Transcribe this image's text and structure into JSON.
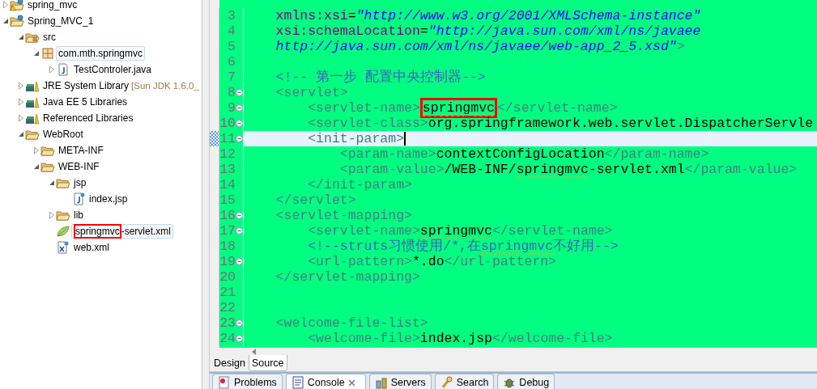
{
  "project_explorer": {
    "items": [
      {
        "label": "spring_mvc",
        "kind": "project-warning",
        "expanded": false,
        "selected": false
      },
      {
        "label": "Spring_MVC_1",
        "kind": "project",
        "expanded": true,
        "selected": false,
        "children": [
          {
            "label": "src",
            "kind": "source-folder",
            "expanded": true,
            "selected": false,
            "children": [
              {
                "label": "com.mth.springmvc",
                "kind": "package",
                "expanded": true,
                "selected": true,
                "children": [
                  {
                    "label": "TestControler.java",
                    "kind": "java-file",
                    "expanded": false,
                    "selected": false
                  }
                ]
              }
            ]
          },
          {
            "label": "JRE System Library",
            "decoration": "[Sun JDK 1.6.0_",
            "kind": "library",
            "expanded": false,
            "selected": false
          },
          {
            "label": "Java EE 5 Libraries",
            "kind": "library",
            "expanded": false,
            "selected": false
          },
          {
            "label": "Referenced Libraries",
            "kind": "library",
            "expanded": false,
            "selected": false
          },
          {
            "label": "WebRoot",
            "kind": "folder",
            "expanded": true,
            "selected": false,
            "children": [
              {
                "label": "META-INF",
                "kind": "folder",
                "expanded": false,
                "selected": false
              },
              {
                "label": "WEB-INF",
                "kind": "folder",
                "expanded": true,
                "selected": false,
                "children": [
                  {
                    "label": "jsp",
                    "kind": "folder",
                    "expanded": true,
                    "selected": false,
                    "children": [
                      {
                        "label": "index.jsp",
                        "kind": "jsp-file",
                        "selected": false
                      }
                    ]
                  },
                  {
                    "label": "lib",
                    "kind": "folder",
                    "expanded": false,
                    "selected": false
                  },
                  {
                    "label_framed": "springmvc",
                    "label": "-servlet.xml",
                    "kind": "spring-file",
                    "selected": true
                  },
                  {
                    "label": "web.xml",
                    "kind": "xml-file",
                    "selected": false
                  }
                ]
              }
            ]
          }
        ]
      }
    ]
  },
  "editor": {
    "lines": [
      {
        "number": "3",
        "foldable": false,
        "current": false,
        "tokens": [
          {
            "kind": "attr",
            "text": "    xmlns:xsi"
          },
          {
            "kind": "plain",
            "text": "="
          },
          {
            "kind": "value",
            "text": "\"http://www.w3.org/2001/XMLSchema-instance\""
          }
        ]
      },
      {
        "number": "4",
        "foldable": false,
        "current": false,
        "tokens": [
          {
            "kind": "attr",
            "text": "    xsi:schemaLocation"
          },
          {
            "kind": "plain",
            "text": "="
          },
          {
            "kind": "value",
            "text": "\"http://java.sun.com/xml/ns/javaee"
          }
        ]
      },
      {
        "number": "5",
        "foldable": false,
        "current": false,
        "tokens": [
          {
            "kind": "value",
            "text": "    http://java.sun.com/xml/ns/javaee/web-app_2_5.xsd\""
          },
          {
            "kind": "tag",
            "text": ">"
          }
        ]
      },
      {
        "number": "6",
        "foldable": false,
        "current": false
      },
      {
        "number": "7",
        "foldable": false,
        "current": false,
        "tokens": [
          {
            "kind": "comment",
            "text": "    <!-- 第一步 配置中央控制器-->"
          }
        ]
      },
      {
        "number": "8",
        "foldable": true,
        "current": false,
        "tokens": [
          {
            "kind": "tag",
            "text": "    <servlet>"
          }
        ]
      },
      {
        "number": "9",
        "foldable": true,
        "current": false,
        "tokens": [
          {
            "kind": "tag",
            "text": "        <servlet-name>"
          },
          {
            "kind": "text",
            "text": "springmvc",
            "misspelled": true,
            "framed": true
          },
          {
            "kind": "tag",
            "text": "</servlet-name>"
          }
        ]
      },
      {
        "number": "10",
        "foldable": true,
        "current": false,
        "tokens": [
          {
            "kind": "tag",
            "text": "        <servlet-class>"
          },
          {
            "kind": "text",
            "text": "org.springframework.web.servlet.DispatcherServle"
          }
        ]
      },
      {
        "number": "11",
        "foldable": true,
        "current": true,
        "tokens": [
          {
            "kind": "tag",
            "text": "        <init-param>"
          }
        ]
      },
      {
        "number": "12",
        "foldable": false,
        "current": false,
        "tokens": [
          {
            "kind": "tag",
            "text": "            <param-name>"
          },
          {
            "kind": "text",
            "text": "contextConfigLocation"
          },
          {
            "kind": "tag",
            "text": "</param-name>"
          }
        ]
      },
      {
        "number": "13",
        "foldable": false,
        "current": false,
        "tokens": [
          {
            "kind": "tag",
            "text": "            <param-value>"
          },
          {
            "kind": "text",
            "text": "/WEB-INF/"
          },
          {
            "kind": "text",
            "text": "springmvc",
            "misspelled": true
          },
          {
            "kind": "text",
            "text": "-servlet.xml"
          },
          {
            "kind": "tag",
            "text": "</param-value>"
          }
        ]
      },
      {
        "number": "14",
        "foldable": false,
        "current": false,
        "tokens": [
          {
            "kind": "tag",
            "text": "        </init-param>"
          }
        ]
      },
      {
        "number": "15",
        "foldable": false,
        "current": false,
        "tokens": [
          {
            "kind": "tag",
            "text": "    </servlet>"
          }
        ]
      },
      {
        "number": "16",
        "foldable": true,
        "current": false,
        "tokens": [
          {
            "kind": "tag",
            "text": "    <servlet-mapping>"
          }
        ]
      },
      {
        "number": "17",
        "foldable": true,
        "current": false,
        "tokens": [
          {
            "kind": "tag",
            "text": "        <servlet-name>"
          },
          {
            "kind": "text",
            "text": "springmvc",
            "misspelled": true
          },
          {
            "kind": "tag",
            "text": "</servlet-name>"
          }
        ]
      },
      {
        "number": "18",
        "foldable": false,
        "current": false,
        "tokens": [
          {
            "kind": "comment",
            "text": "        <!--struts习惯使用/*,在"
          },
          {
            "kind": "comment",
            "text": "springmvc",
            "misspelled": true
          },
          {
            "kind": "comment",
            "text": "不好用-->"
          }
        ]
      },
      {
        "number": "19",
        "foldable": true,
        "current": false,
        "tokens": [
          {
            "kind": "tag",
            "text": "        <url-pattern>"
          },
          {
            "kind": "text",
            "text": "*.do"
          },
          {
            "kind": "tag",
            "text": "</url-pattern>"
          }
        ]
      },
      {
        "number": "20",
        "foldable": false,
        "current": false,
        "tokens": [
          {
            "kind": "tag",
            "text": "    </servlet-mapping>"
          }
        ]
      },
      {
        "number": "21",
        "foldable": false,
        "current": false
      },
      {
        "number": "22",
        "foldable": false,
        "current": false
      },
      {
        "number": "23",
        "foldable": true,
        "current": false,
        "tokens": [
          {
            "kind": "tag",
            "text": "    <welcome-file-list>"
          }
        ]
      },
      {
        "number": "24",
        "foldable": true,
        "current": false,
        "tokens": [
          {
            "kind": "tag",
            "text": "        <welcome-file>"
          },
          {
            "kind": "text",
            "text": "index.jsp"
          },
          {
            "kind": "tag",
            "text": "</welcome-file>"
          }
        ]
      }
    ]
  },
  "editor_tabs": [
    {
      "label": "Design",
      "selected": false
    },
    {
      "label": "Source",
      "selected": true
    }
  ],
  "view_tabs": [
    {
      "label": "Problems",
      "kind": "problems",
      "selected": false,
      "closable": false
    },
    {
      "label": "Console",
      "kind": "console",
      "selected": true,
      "closable": true
    },
    {
      "label": "Servers",
      "kind": "servers",
      "selected": false,
      "closable": false
    },
    {
      "label": "Search",
      "kind": "search",
      "selected": false,
      "closable": false
    },
    {
      "label": "Debug",
      "kind": "debug",
      "selected": false,
      "closable": false
    }
  ]
}
